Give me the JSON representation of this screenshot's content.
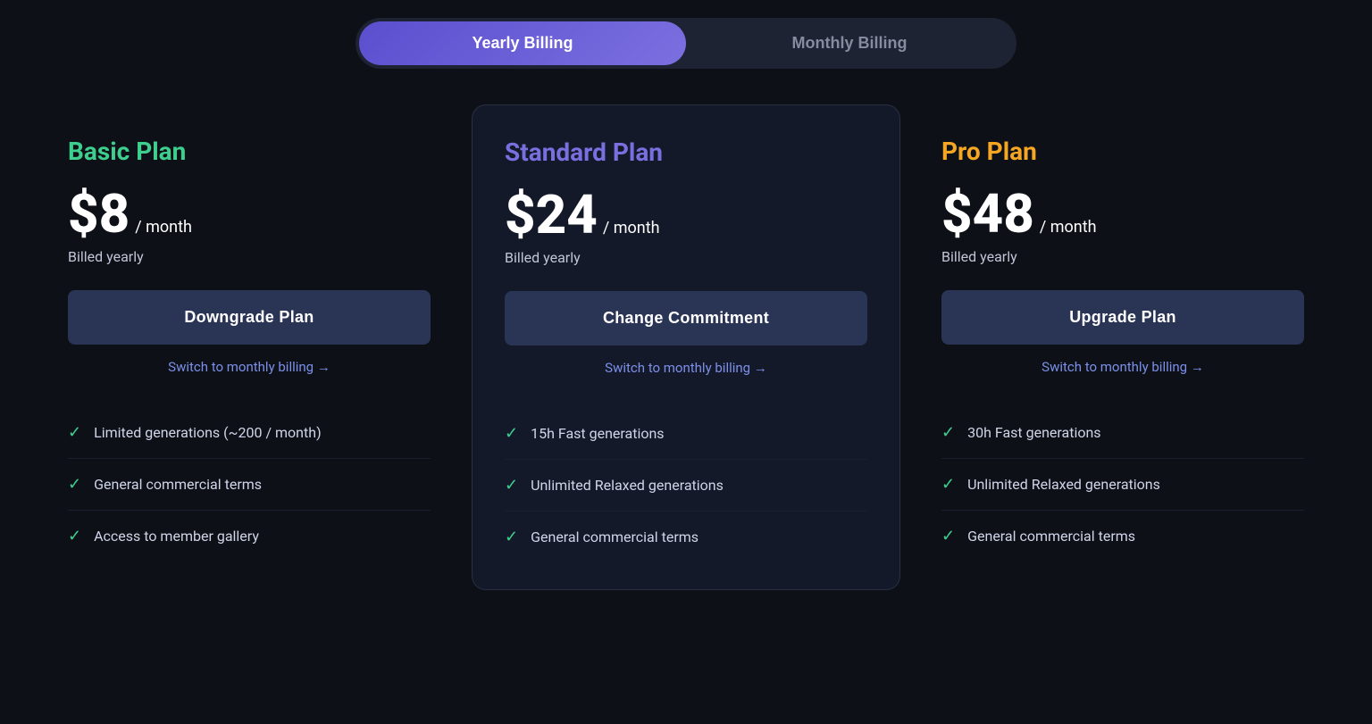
{
  "billing": {
    "toggle_yearly_label": "Yearly Billing",
    "toggle_monthly_label": "Monthly Billing",
    "yearly_active": true
  },
  "plans": [
    {
      "id": "basic",
      "title": "Basic Plan",
      "title_class": "basic",
      "price": "$8",
      "period": "/ month",
      "billed_note": "Billed yearly",
      "action_label": "Downgrade Plan",
      "switch_label": "Switch to monthly billing →",
      "features": [
        "Limited generations (~200 / month)",
        "General commercial terms",
        "Access to member gallery"
      ]
    },
    {
      "id": "standard",
      "title": "Standard Plan",
      "title_class": "standard",
      "price": "$24",
      "period": "/ month",
      "billed_note": "Billed yearly",
      "action_label": "Change Commitment",
      "switch_label": "Switch to monthly billing →",
      "features": [
        "15h Fast generations",
        "Unlimited Relaxed generations",
        "General commercial terms"
      ]
    },
    {
      "id": "pro",
      "title": "Pro Plan",
      "title_class": "pro",
      "price": "$48",
      "period": "/ month",
      "billed_note": "Billed yearly",
      "action_label": "Upgrade Plan",
      "switch_label": "Switch to monthly billing →",
      "features": [
        "30h Fast generations",
        "Unlimited Relaxed generations",
        "General commercial terms"
      ]
    }
  ]
}
